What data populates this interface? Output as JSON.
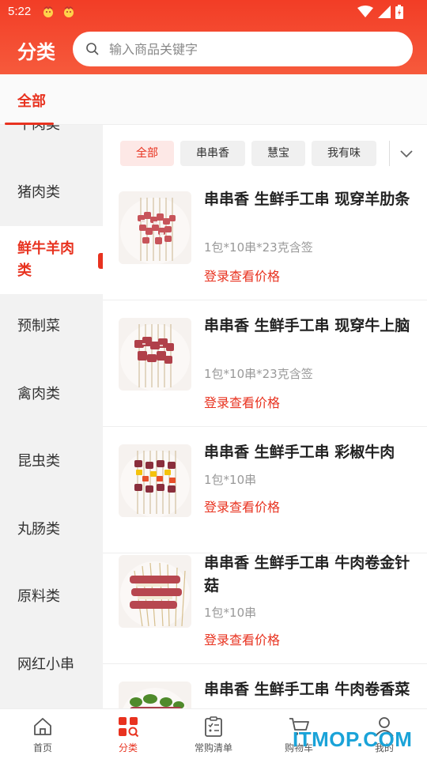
{
  "status_bar": {
    "time": "5:22"
  },
  "header": {
    "title": "分类",
    "search_placeholder": "输入商品关键字"
  },
  "top_tabs": [
    {
      "label": "全部",
      "active": true
    }
  ],
  "sidebar": {
    "items": [
      {
        "label": "牛肉类"
      },
      {
        "label": "猪肉类"
      },
      {
        "label": "鲜牛羊肉类",
        "active": true
      },
      {
        "label": "预制菜"
      },
      {
        "label": "禽肉类"
      },
      {
        "label": "昆虫类"
      },
      {
        "label": "丸肠类"
      },
      {
        "label": "原料类"
      },
      {
        "label": "网红小串"
      }
    ]
  },
  "chips": [
    {
      "label": "全部",
      "active": true
    },
    {
      "label": "串串香"
    },
    {
      "label": "慧宝"
    },
    {
      "label": "我有味"
    }
  ],
  "products": [
    {
      "name": "串串香 生鲜手工串 现穿羊肋条",
      "spec": "1包*10串*23克含签",
      "price_text": "登录查看价格"
    },
    {
      "name": "串串香 生鲜手工串 现穿牛上脑",
      "spec": "1包*10串*23克含签",
      "price_text": "登录查看价格"
    },
    {
      "name": "串串香 生鲜手工串 彩椒牛肉",
      "spec": "1包*10串",
      "price_text": "登录查看价格"
    },
    {
      "name": "串串香 生鲜手工串 牛肉卷金针菇",
      "spec": "1包*10串",
      "price_text": "登录查看价格"
    },
    {
      "name": "串串香 生鲜手工串 牛肉卷香菜",
      "spec": "",
      "price_text": ""
    }
  ],
  "bottom_nav": [
    {
      "label": "首页",
      "icon": "home-icon"
    },
    {
      "label": "分类",
      "icon": "category-icon",
      "active": true
    },
    {
      "label": "常购清单",
      "icon": "list-icon"
    },
    {
      "label": "购物车",
      "icon": "cart-icon"
    },
    {
      "label": "我的",
      "icon": "user-icon"
    }
  ],
  "watermark": "ITMOP.COM",
  "colors": {
    "brand": "#e8321f",
    "header": "#f23d26",
    "chip_active_bg": "#fde8e6"
  }
}
